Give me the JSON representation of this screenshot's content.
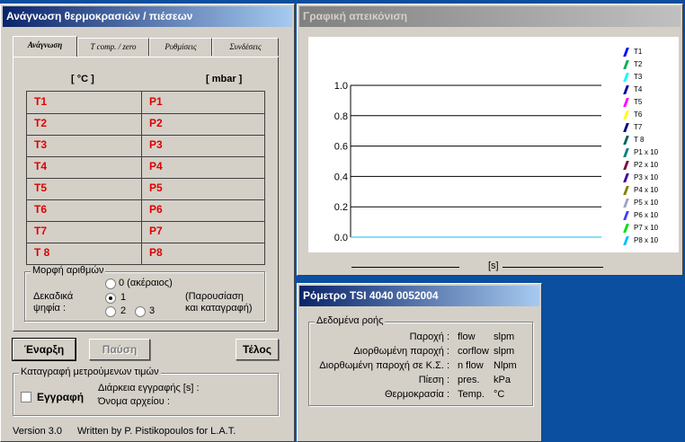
{
  "left_window": {
    "title": "Ανάγνωση θερμοκρασιών / πιέσεων",
    "tabs": [
      {
        "label": "Ανάγνωση",
        "active": true
      },
      {
        "label": "T comp. / zero",
        "active": false
      },
      {
        "label": "Ρυθμίσεις",
        "active": false
      },
      {
        "label": "Συνδέσεις",
        "active": false
      }
    ],
    "unit_temp": "[ °C ]",
    "unit_pres": "[ mbar ]",
    "rows": [
      {
        "t": "T1",
        "p": "P1"
      },
      {
        "t": "T2",
        "p": "P2"
      },
      {
        "t": "T3",
        "p": "P3"
      },
      {
        "t": "T4",
        "p": "P4"
      },
      {
        "t": "T5",
        "p": "P5"
      },
      {
        "t": "T6",
        "p": "P6"
      },
      {
        "t": "T7",
        "p": "P7"
      },
      {
        "t": "T 8",
        "p": "P8"
      }
    ],
    "format": {
      "legend": "Μορφή αριθμών",
      "integer": "0 (ακέραιος)",
      "decimals_label_1": "Δεκαδικά",
      "decimals_label_2": "ψηφία :",
      "opt1": "1",
      "opt2": "2",
      "opt3": "3",
      "note_1": "(Παρουσίαση",
      "note_2": "και καταγραφή)",
      "selected": "1"
    },
    "buttons": {
      "start": "Έναρξη",
      "pause": "Παύση",
      "end": "Τέλος"
    },
    "record": {
      "legend": "Καταγραφή μετρούμενων τιμών",
      "checkbox": "Εγγραφή",
      "duration": "Διάρκεια εγγραφής [s] :",
      "filename": "Όνομα αρχείου :"
    },
    "footer": {
      "version": "Version 3.0",
      "credit": "Written by P. Pistikopoulos for L.A.T."
    }
  },
  "chart_window": {
    "title": "Γραφική απεικόνιση"
  },
  "chart_data": {
    "type": "line",
    "xlabel": "[s]",
    "ylim": [
      0,
      1.0
    ],
    "yticks": [
      "0.0",
      "0.2",
      "0.4",
      "0.6",
      "0.8",
      "1.0"
    ],
    "grid": true,
    "legend_position": "right",
    "series": [
      {
        "name": "T1",
        "color": "#0000ff",
        "values": [
          0
        ]
      },
      {
        "name": "T2",
        "color": "#00b050",
        "values": [
          0
        ]
      },
      {
        "name": "T3",
        "color": "#00ffff",
        "values": [
          0
        ]
      },
      {
        "name": "T4",
        "color": "#0000a0",
        "values": [
          0
        ]
      },
      {
        "name": "T5",
        "color": "#ff00ff",
        "values": [
          0
        ]
      },
      {
        "name": "T6",
        "color": "#ffff00",
        "values": [
          0
        ]
      },
      {
        "name": "T7",
        "color": "#000080",
        "values": [
          0
        ]
      },
      {
        "name": "T 8",
        "color": "#006060",
        "values": [
          0
        ]
      },
      {
        "name": "P1 x 10",
        "color": "#008080",
        "values": [
          0
        ]
      },
      {
        "name": "P2 x 10",
        "color": "#800040",
        "values": [
          0
        ]
      },
      {
        "name": "P3 x 10",
        "color": "#4000a0",
        "values": [
          0
        ]
      },
      {
        "name": "P4 x 10",
        "color": "#808000",
        "values": [
          0
        ]
      },
      {
        "name": "P5 x 10",
        "color": "#a0a0c0",
        "values": [
          0
        ]
      },
      {
        "name": "P6 x 10",
        "color": "#4040ff",
        "values": [
          0
        ]
      },
      {
        "name": "P7 x 10",
        "color": "#00e000",
        "values": [
          0
        ]
      },
      {
        "name": "P8 x 10",
        "color": "#00c0ff",
        "values": [
          0
        ]
      }
    ]
  },
  "flow_window": {
    "title": "Ρόμετρο TSI 4040 0052004",
    "legend": "Δεδομένα ροής",
    "rows": [
      {
        "label": "Παροχή :",
        "var": "flow",
        "unit": "slpm"
      },
      {
        "label": "Διορθωμένη παροχή :",
        "var": "corflow",
        "unit": "slpm"
      },
      {
        "label": "Διορθωμένη παροχή σε Κ.Σ. :",
        "var": "n flow",
        "unit": "Nlpm"
      },
      {
        "label": "Πίεση :",
        "var": "pres.",
        "unit": "kPa"
      },
      {
        "label": "Θερμοκρασία :",
        "var": "Temp.",
        "unit": "°C"
      }
    ]
  }
}
